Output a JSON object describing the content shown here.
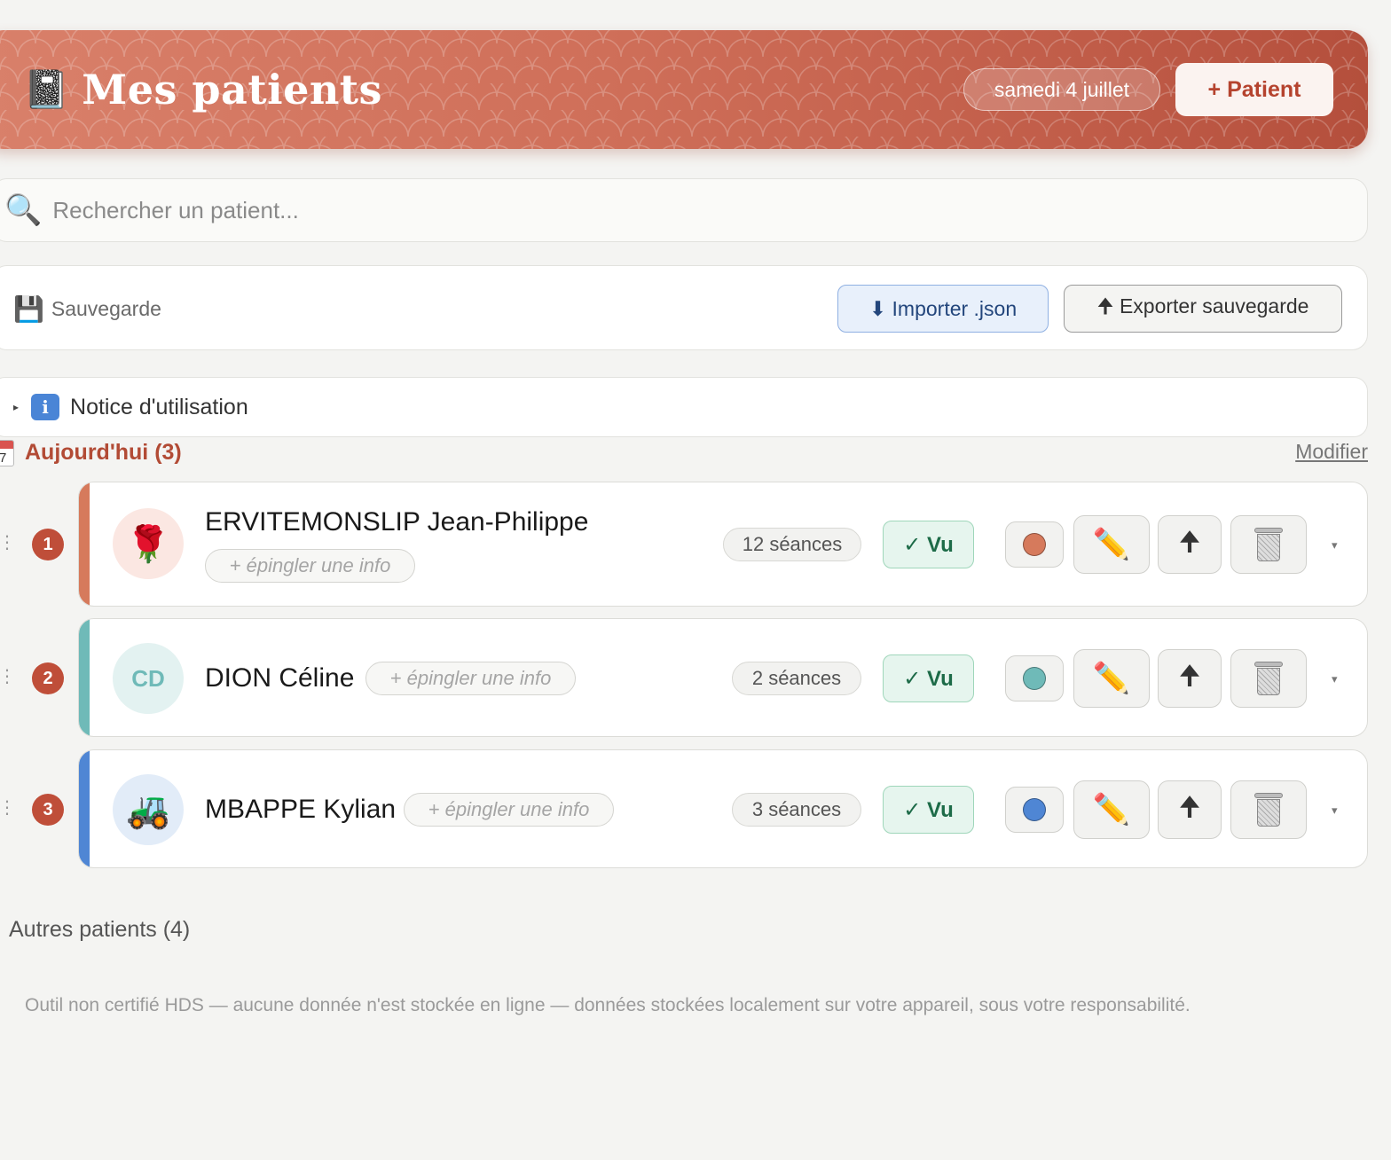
{
  "header": {
    "icon": "notebook-icon",
    "title": "Mes patients",
    "date": "samedi 4 juillet",
    "add_patient_label": "+ Patient"
  },
  "search": {
    "icon": "magnifier-icon",
    "placeholder": "Rechercher un patient..."
  },
  "backup": {
    "icon": "floppy-disk-icon",
    "label": "Sauvegarde",
    "import_label": "⬇ Importer .json",
    "export_label": "🠉 Exporter sauvegarde"
  },
  "notice": {
    "icon": "info-icon",
    "label": "Notice d'utilisation"
  },
  "today": {
    "icon": "calendar-icon",
    "calendar_day": "7",
    "title": "Aujourd'hui (3)",
    "modify_label": "Modifier",
    "patients": [
      {
        "index": "1",
        "name": "ERVITEMONSLIP Jean-Philippe",
        "avatar": "🌹",
        "avatar_kind": "rose-icon",
        "pin_label": "+ épingler une info",
        "sessions": "12 séances",
        "seen_label": "✓ Vu",
        "color": "#d67a5c",
        "avatar_bg": "#fbe7e2",
        "edit_icon": "✏️",
        "up_icon": "🠉",
        "menu_icon": "▾"
      },
      {
        "index": "2",
        "name": "DION Céline",
        "avatar": "CD",
        "avatar_kind": "initials",
        "pin_label": "+ épingler une info",
        "sessions": "2 séances",
        "seen_label": "✓ Vu",
        "color": "#6fbab8",
        "avatar_bg": "#e3f2f1",
        "avatar_fg": "#6fbab8",
        "edit_icon": "✏️",
        "up_icon": "🠉",
        "menu_icon": "▾"
      },
      {
        "index": "3",
        "name": "MBAPPE Kylian",
        "avatar": "🚜",
        "avatar_kind": "tractor-icon",
        "pin_label": "+ épingler une info",
        "sessions": "3 séances",
        "seen_label": "✓ Vu",
        "color": "#4f86d4",
        "avatar_bg": "#e2ecf8",
        "edit_icon": "✏️",
        "up_icon": "🠉",
        "menu_icon": "▾"
      }
    ]
  },
  "others": {
    "title": "Autres patients (4)"
  },
  "footer": {
    "disclaimer": "Outil non certifié HDS — aucune donnée n'est stockée en ligne — données stockées localement sur votre appareil, sous votre responsabilité."
  }
}
